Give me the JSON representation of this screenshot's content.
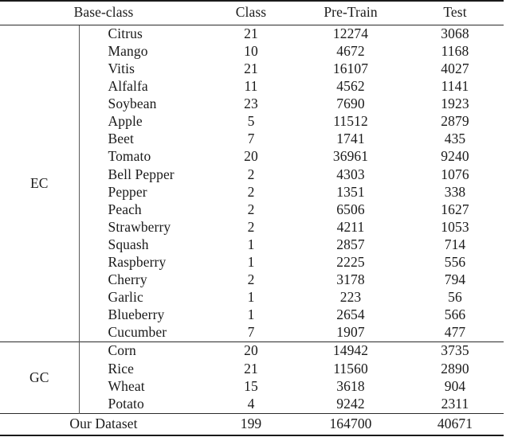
{
  "table": {
    "caption_present": false,
    "columns": [
      {
        "key": "base_class",
        "label": "Base-class",
        "span": 2
      },
      {
        "key": "class",
        "label": "Class",
        "span": 1
      },
      {
        "key": "pre_train",
        "label": "Pre-Train",
        "span": 1
      },
      {
        "key": "test",
        "label": "Test",
        "span": 1
      }
    ],
    "groups": [
      {
        "label": "EC",
        "rows": [
          {
            "base_class": "Citrus",
            "class": "21",
            "pre_train": "12274",
            "test": "3068"
          },
          {
            "base_class": "Mango",
            "class": "10",
            "pre_train": "4672",
            "test": "1168"
          },
          {
            "base_class": "Vitis",
            "class": "21",
            "pre_train": "16107",
            "test": "4027"
          },
          {
            "base_class": "Alfalfa",
            "class": "11",
            "pre_train": "4562",
            "test": "1141"
          },
          {
            "base_class": "Soybean",
            "class": "23",
            "pre_train": "7690",
            "test": "1923"
          },
          {
            "base_class": "Apple",
            "class": "5",
            "pre_train": "11512",
            "test": "2879"
          },
          {
            "base_class": "Beet",
            "class": "7",
            "pre_train": "1741",
            "test": "435"
          },
          {
            "base_class": "Tomato",
            "class": "20",
            "pre_train": "36961",
            "test": "9240"
          },
          {
            "base_class": "Bell Pepper",
            "class": "2",
            "pre_train": "4303",
            "test": "1076"
          },
          {
            "base_class": "Pepper",
            "class": "2",
            "pre_train": "1351",
            "test": "338"
          },
          {
            "base_class": "Peach",
            "class": "2",
            "pre_train": "6506",
            "test": "1627"
          },
          {
            "base_class": "Strawberry",
            "class": "2",
            "pre_train": "4211",
            "test": "1053"
          },
          {
            "base_class": "Squash",
            "class": "1",
            "pre_train": "2857",
            "test": "714"
          },
          {
            "base_class": "Raspberry",
            "class": "1",
            "pre_train": "2225",
            "test": "556"
          },
          {
            "base_class": "Cherry",
            "class": "2",
            "pre_train": "3178",
            "test": "794"
          },
          {
            "base_class": "Garlic",
            "class": "1",
            "pre_train": "223",
            "test": "56"
          },
          {
            "base_class": "Blueberry",
            "class": "1",
            "pre_train": "2654",
            "test": "566"
          },
          {
            "base_class": "Cucumber",
            "class": "7",
            "pre_train": "1907",
            "test": "477"
          }
        ]
      },
      {
        "label": "GC",
        "rows": [
          {
            "base_class": "Corn",
            "class": "20",
            "pre_train": "14942",
            "test": "3735"
          },
          {
            "base_class": "Rice",
            "class": "21",
            "pre_train": "11560",
            "test": "2890"
          },
          {
            "base_class": "Wheat",
            "class": "15",
            "pre_train": "3618",
            "test": "904"
          },
          {
            "base_class": "Potato",
            "class": "4",
            "pre_train": "9242",
            "test": "2311"
          }
        ]
      }
    ],
    "total_row": {
      "label": "Our Dataset",
      "class": "199",
      "pre_train": "164700",
      "test": "40671"
    }
  },
  "colors": {
    "text": "#1a1a1a",
    "rule_heavy": "#1a1a1a",
    "rule_thin": "#2a2a2a",
    "rule_vertical": "#5a5a5a",
    "background": "#ffffff"
  }
}
